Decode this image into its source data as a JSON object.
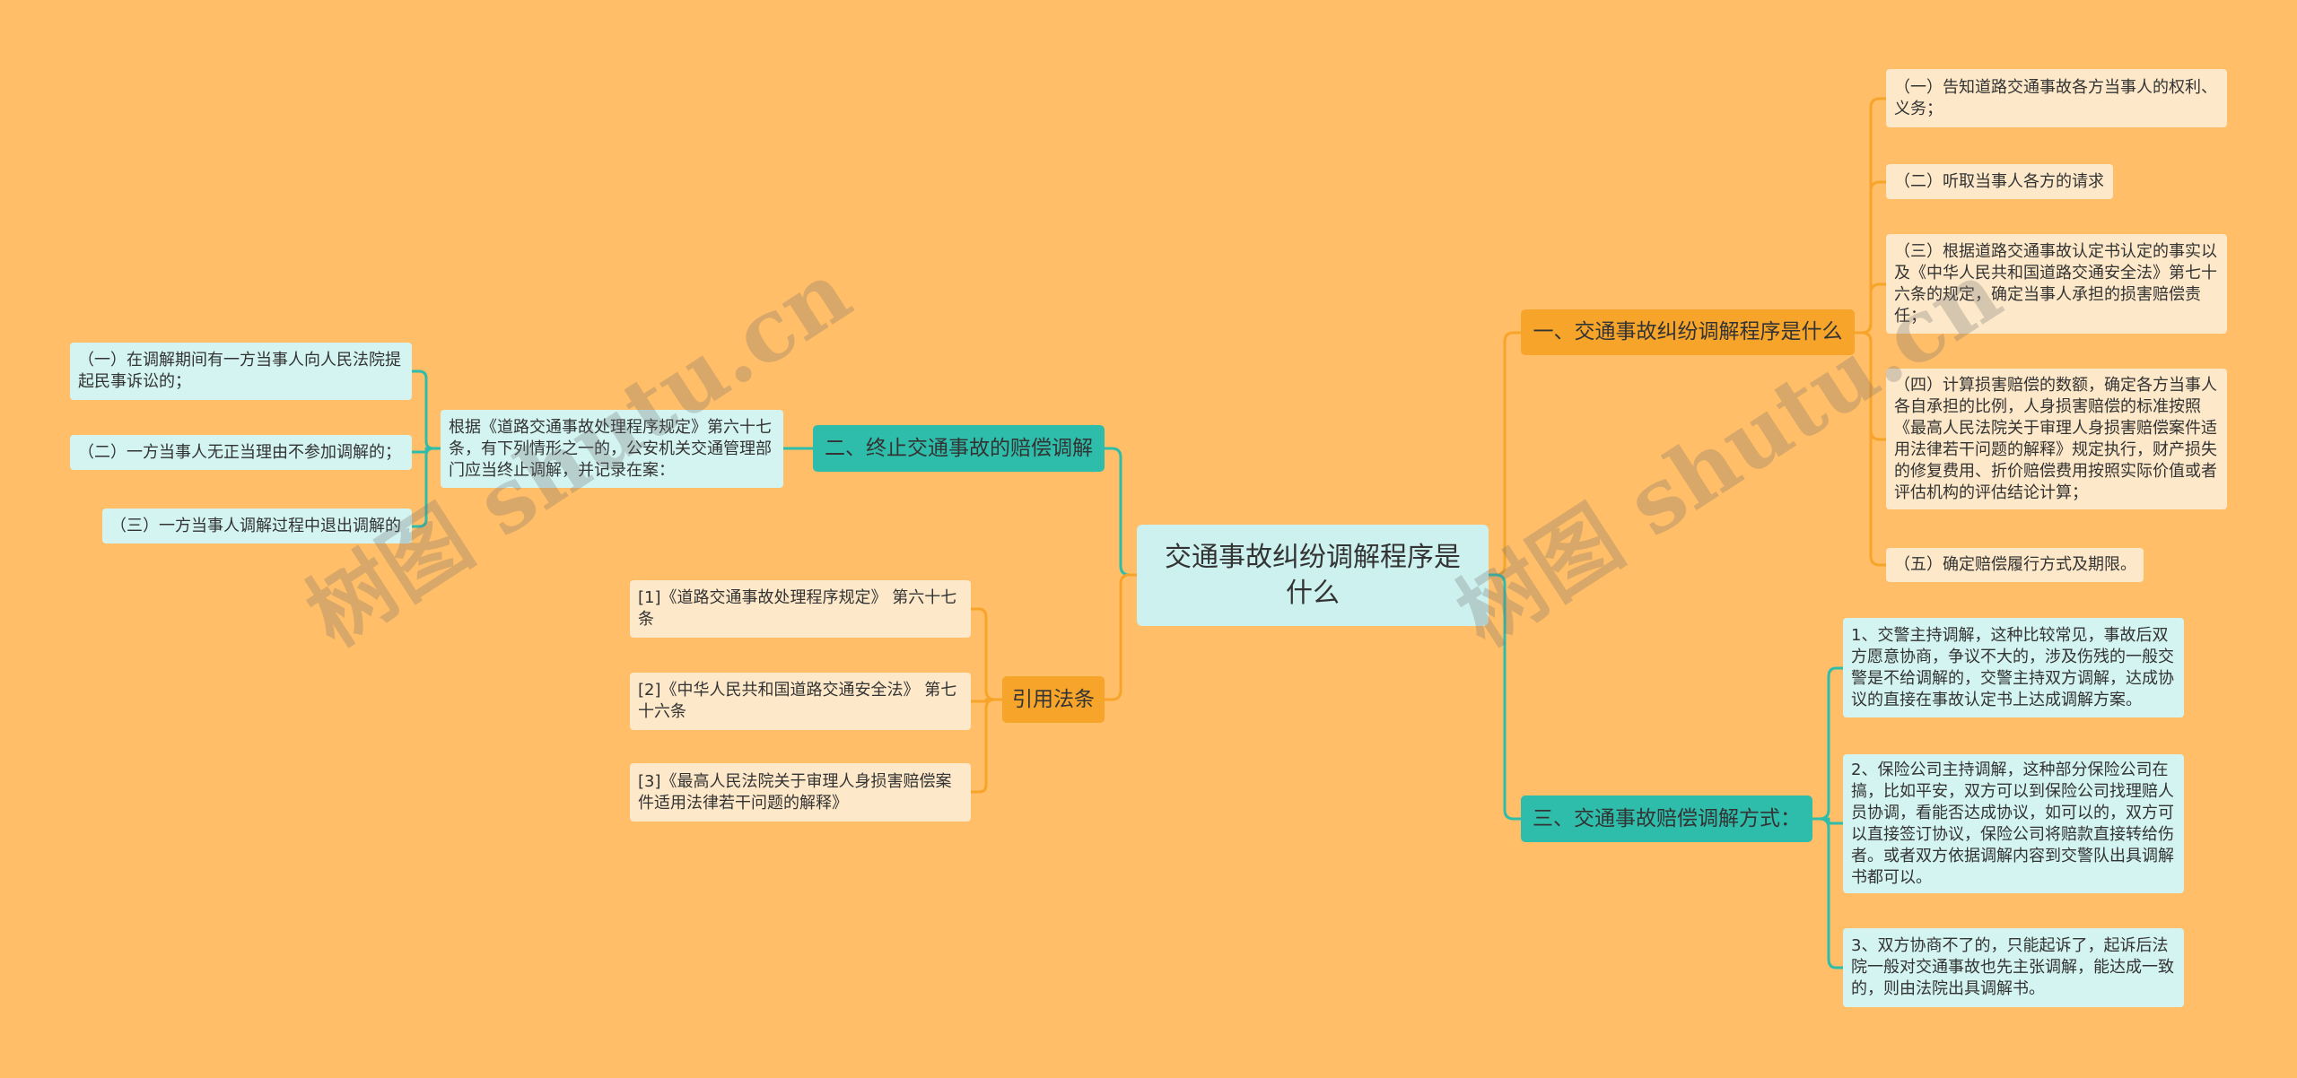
{
  "center": {
    "title": "交通事故纠纷调解程序是什么"
  },
  "branches": {
    "procedure": {
      "label": "一、交通事故纠纷调解程序是什么",
      "items": [
        "（一）告知道路交通事故各方当事人的权利、义务；",
        "（二）听取当事人各方的请求",
        "（三）根据道路交通事故认定书认定的事实以及《中华人民共和国道路交通安全法》第七十六条的规定，确定当事人承担的损害赔偿责任；",
        "（四）计算损害赔偿的数额，确定各方当事人各自承担的比例，人身损害赔偿的标准按照《最高人民法院关于审理人身损害赔偿案件适用法律若干问题的解释》规定执行，财产损失的修复费用、折价赔偿费用按照实际价值或者评估机构的评估结论计算；",
        "（五）确定赔偿履行方式及期限。"
      ]
    },
    "methods": {
      "label": "三、交通事故赔偿调解方式：",
      "items": [
        "1、交警主持调解，这种比较常见，事故后双方愿意协商，争议不大的，涉及伤残的一般交警是不给调解的，交警主持双方调解，达成协议的直接在事故认定书上达成调解方案。",
        "2、保险公司主持调解，这种部分保险公司在搞，比如平安，双方可以到保险公司找理赔人员协调，看能否达成协议，如可以的，双方可以直接签订协议，保险公司将赔款直接转给伤者。或者双方依据调解内容到交警队出具调解书都可以。",
        "3、双方协商不了的，只能起诉了，起诉后法院一般对交通事故也先主张调解，能达成一致的，则由法院出具调解书。"
      ]
    },
    "termination": {
      "label": "二、终止交通事故的赔偿调解",
      "basis": "根据《道路交通事故处理程序规定》第六十七条，有下列情形之一的，公安机关交通管理部门应当终止调解，并记录在案：",
      "items": [
        "（一）在调解期间有一方当事人向人民法院提起民事诉讼的；",
        "（二）一方当事人无正当理由不参加调解的；",
        "（三）一方当事人调解过程中退出调解的"
      ]
    },
    "citations": {
      "label": "引用法条",
      "items": [
        "[1]《道路交通事故处理程序规定》 第六十七条",
        "[2]《中华人民共和国道路交通安全法》 第七十六条",
        "[3]《最高人民法院关于审理人身损害赔偿案件适用法律若干问题的解释》"
      ]
    }
  },
  "watermark": "树图 shutu.cn",
  "colors": {
    "background": "#ffbe67",
    "orange": "#f7a52a",
    "teal": "#2fbdab",
    "center_fill": "#cdf1ee",
    "cream_leaf": "#fde8c9",
    "cyan_leaf": "#d3f4f0"
  }
}
